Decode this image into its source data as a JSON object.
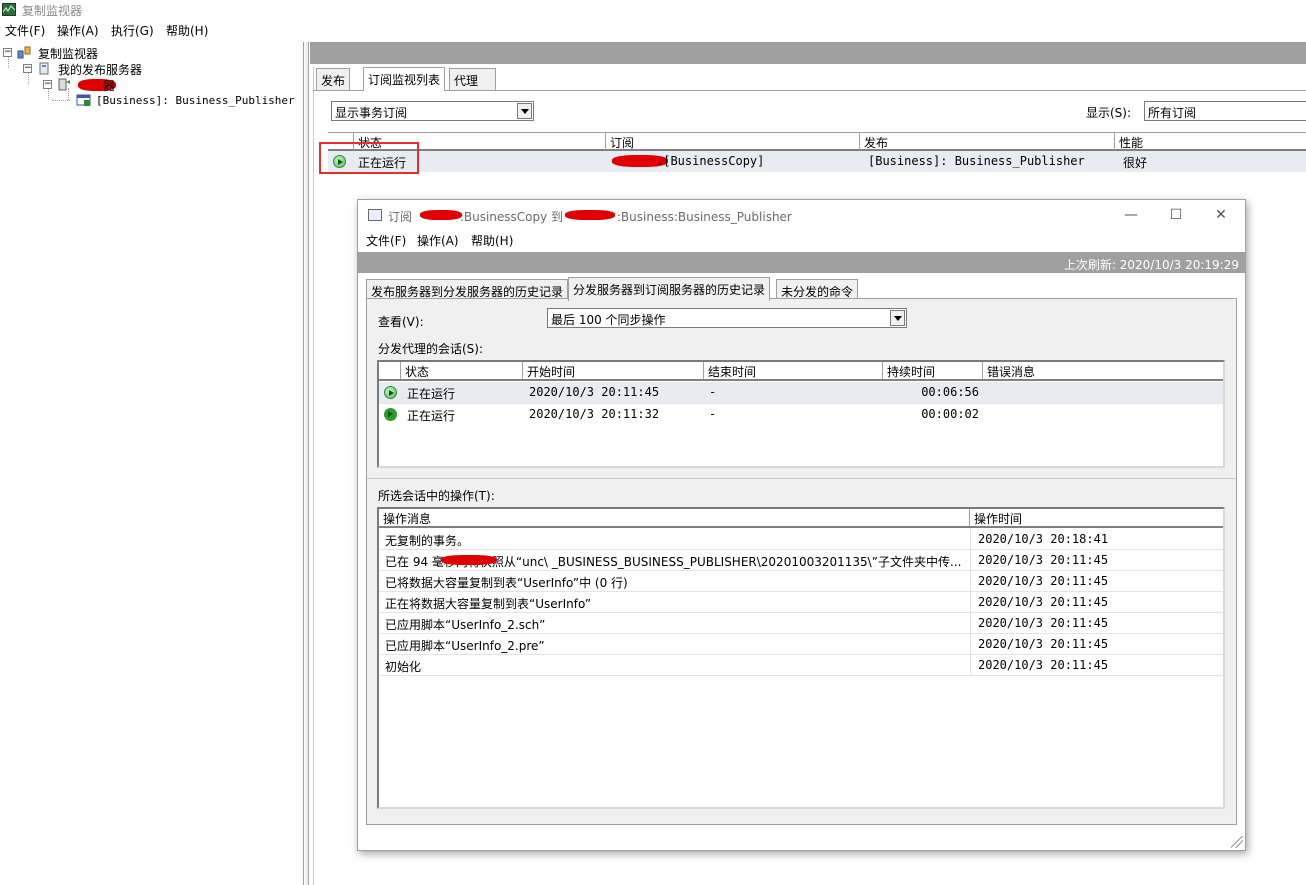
{
  "app": {
    "title": "复制监视器",
    "menu": [
      "文件(F)",
      "操作(A)",
      "执行(G)",
      "帮助(H)"
    ]
  },
  "tree": {
    "root": "复制监视器",
    "publishers": "我的发布服务器",
    "server_suffix": "器",
    "publication": "[Business]: Business_Publisher"
  },
  "right": {
    "tabs": [
      "发布",
      "订阅监视列表",
      "代理"
    ],
    "view_combo": "显示事务订阅",
    "show_label": "显示(S):",
    "show_combo": "所有订阅",
    "grid": {
      "columns": [
        "状态",
        "订阅",
        "发布",
        "性能"
      ],
      "row": {
        "status": "正在运行",
        "subscription": ".[BusinessCopy]",
        "publication": "[Business]: Business_Publisher",
        "performance": "很好"
      }
    }
  },
  "dialog": {
    "title_prefix": "订阅 ",
    "title_mid": ":BusinessCopy 到 ",
    "title_suffix": ":Business:Business_Publisher",
    "menu": [
      "文件(F)",
      "操作(A)",
      "帮助(H)"
    ],
    "last_refresh": "上次刷新: 2020/10/3 20:19:29",
    "tabs": [
      "发布服务器到分发服务器的历史记录",
      "分发服务器到订阅服务器的历史记录",
      "未分发的命令"
    ],
    "view_label": "查看(V):",
    "view_combo": "最后 100 个同步操作",
    "sessions_label": "分发代理的会话(S):",
    "sessions": {
      "columns": [
        "状态",
        "开始时间",
        "结束时间",
        "持续时间",
        "错误消息"
      ],
      "rows": [
        {
          "status": "正在运行",
          "start": "2020/10/3 20:11:45",
          "end": "-",
          "duration": "00:06:56",
          "error": ""
        },
        {
          "status": "正在运行",
          "start": "2020/10/3 20:11:32",
          "end": "-",
          "duration": "00:00:02",
          "error": ""
        }
      ]
    },
    "actions_label": "所选会话中的操作(T):",
    "actions": {
      "columns": [
        "操作消息",
        "操作时间"
      ],
      "rows": [
        {
          "message": "无复制的事务。",
          "time": "2020/10/3 20:18:41"
        },
        {
          "message": "已在 94 毫秒内将快照从“unc\\        _BUSINESS_BUSINESS_PUBLISHER\\20201003201135\\”子文件夹中传...",
          "time": "2020/10/3 20:11:45"
        },
        {
          "message": "已将数据大容量复制到表“UserInfo”中 (0 行)",
          "time": "2020/10/3 20:11:45"
        },
        {
          "message": "正在将数据大容量复制到表“UserInfo”",
          "time": "2020/10/3 20:11:45"
        },
        {
          "message": "已应用脚本“UserInfo_2.sch”",
          "time": "2020/10/3 20:11:45"
        },
        {
          "message": "已应用脚本“UserInfo_2.pre”",
          "time": "2020/10/3 20:11:45"
        },
        {
          "message": "初始化",
          "time": "2020/10/3 20:11:45"
        }
      ]
    }
  },
  "colors": {
    "header_gray": "#a0a0a0",
    "selected_row": "#e8ecf2",
    "redaction": "#e00000",
    "highlight_box": "#e03030"
  }
}
